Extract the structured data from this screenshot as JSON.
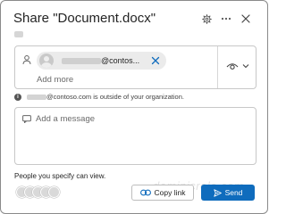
{
  "dialog": {
    "title": "Share \"Document.docx\"",
    "settings_icon": "gear-icon",
    "more_icon": "ellipsis-icon",
    "close_icon": "close-icon"
  },
  "recipients": {
    "person_icon": "person-icon",
    "chip_text": "@contos...",
    "chip_remove_icon": "close-icon",
    "add_more": "Add more",
    "permission_icon": "eye-icon",
    "permission_chevron": "chevron-down-icon"
  },
  "warning": {
    "icon": "info-icon",
    "text": "@contoso.com is outside of your organization."
  },
  "message": {
    "icon": "message-icon",
    "placeholder": "Add a message"
  },
  "footer": {
    "people_text": "People you specify can view.",
    "copy_link_label": "Copy link",
    "send_label": "Send"
  },
  "colors": {
    "accent": "#0f6cbd",
    "copy_link_icon": "#0f6cbd"
  },
  "watermark": "dominicrolo.com"
}
